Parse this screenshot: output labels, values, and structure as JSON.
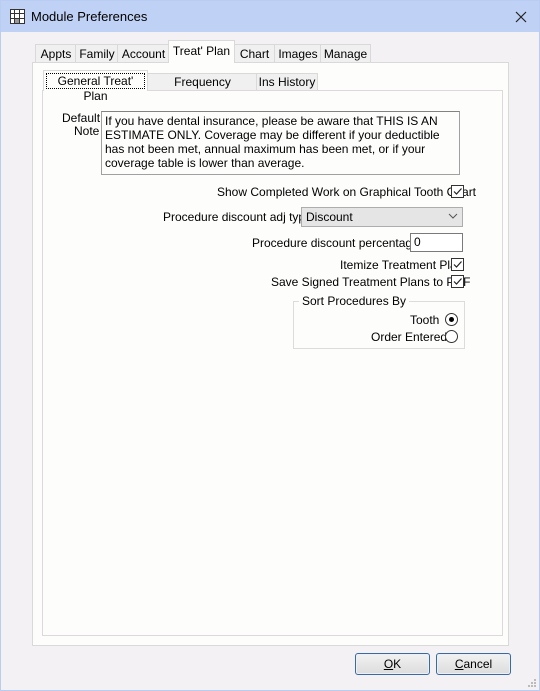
{
  "window": {
    "title": "Module Preferences",
    "icon": "grid-app-icon",
    "close_icon": "close-icon"
  },
  "tabs": [
    {
      "label": "Appts",
      "active": false
    },
    {
      "label": "Family",
      "active": false
    },
    {
      "label": "Account",
      "active": false
    },
    {
      "label": "Treat' Plan",
      "active": true
    },
    {
      "label": "Chart",
      "active": false
    },
    {
      "label": "Images",
      "active": false
    },
    {
      "label": "Manage",
      "active": false
    }
  ],
  "subtabs": [
    {
      "label": "General Treat' Plan",
      "active": true
    },
    {
      "label": "Frequency Checking",
      "active": false
    },
    {
      "label": "Ins History",
      "active": false
    }
  ],
  "form": {
    "default_note_label_line1": "Default",
    "default_note_label_line2": "Note",
    "default_note_value": "If you have dental insurance, please be aware that THIS IS AN ESTIMATE ONLY.  Coverage may be different if your deductible has not been met, annual maximum has been met, or if your coverage table is lower than average.",
    "show_completed_work": {
      "label": "Show Completed Work on Graphical Tooth Chart",
      "checked": true
    },
    "discount_adj_type": {
      "label": "Procedure discount adj type",
      "value": "Discount"
    },
    "discount_percentage": {
      "label": "Procedure discount percentage",
      "value": "0"
    },
    "itemize_treatment_plan": {
      "label": "Itemize Treatment Plan",
      "checked": true
    },
    "save_signed_pdf": {
      "label": "Save Signed Treatment Plans to PDF",
      "checked": true
    },
    "sort_procedures": {
      "title": "Sort Procedures By",
      "options": [
        {
          "label": "Tooth",
          "selected": true
        },
        {
          "label": "Order Entered",
          "selected": false
        }
      ]
    }
  },
  "buttons": {
    "ok": {
      "label_accel": "O",
      "label_rest": "K"
    },
    "cancel": {
      "label_accel": "C",
      "label_rest": "ancel"
    }
  }
}
